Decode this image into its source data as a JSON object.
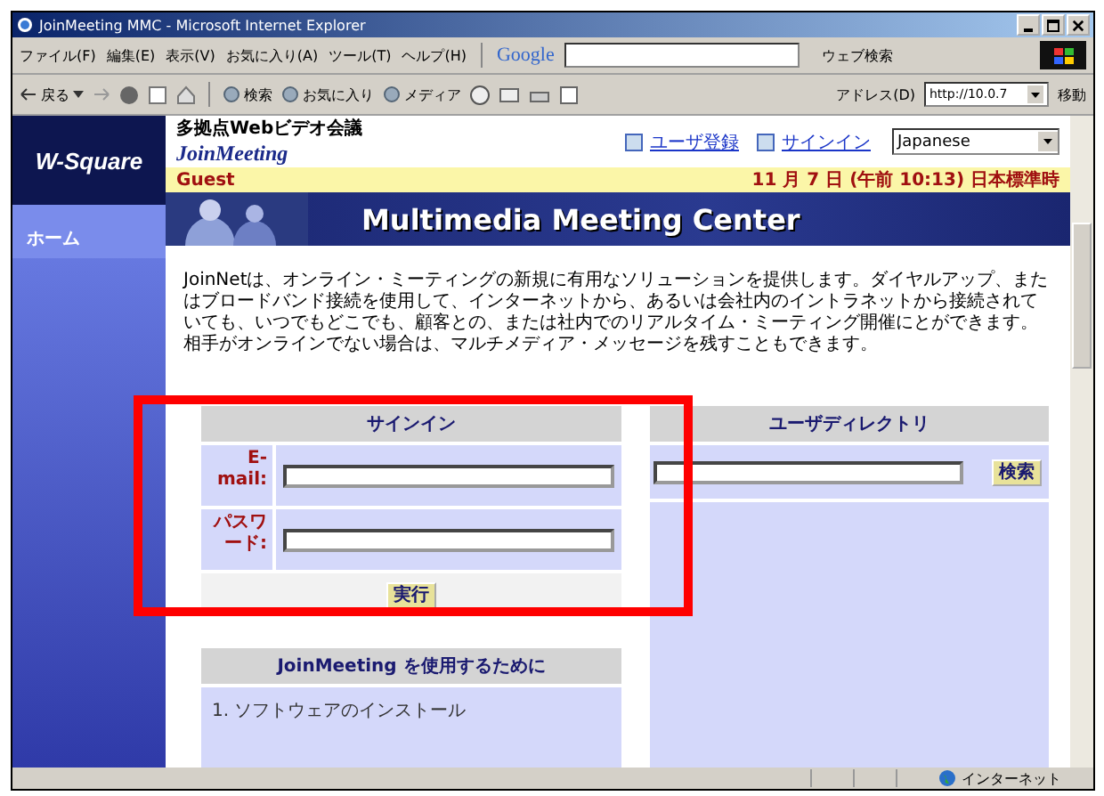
{
  "window": {
    "title": "JoinMeeting MMC - Microsoft Internet Explorer"
  },
  "menu": [
    "ファイル(F)",
    "編集(E)",
    "表示(V)",
    "お気に入り(A)",
    "ツール(T)",
    "ヘルプ(H)"
  ],
  "google_bar": {
    "logo": "Google",
    "search_button": "ウェブ検索"
  },
  "toolbar": {
    "back": "戻る",
    "buttons": [
      "検索",
      "お気に入り",
      "メディア"
    ],
    "address_label": "アドレス(D)",
    "address": "http://10.0.7",
    "go": "移動"
  },
  "header": {
    "tagline": "多拠点Webビデオ会議",
    "product": "JoinMeeting",
    "logo": "W-Square",
    "links": [
      "ユーザ登録",
      "サインイン"
    ],
    "language": "Japanese"
  },
  "info_bar": {
    "user": "Guest",
    "date": "11 月 7 日 (午前 10:13) 日本標準時"
  },
  "banner": {
    "title": "Multimedia Meeting Center"
  },
  "sidebar": {
    "items": [
      "ホーム"
    ]
  },
  "intro": "JoinNetは、オンライン・ミーティングの新規に有用なソリューションを提供します。ダイヤルアップ、またはブロードバンド接続を使用して、インターネットから、あるいは会社内のイントラネットから接続されていても、いつでもどこでも、顧客との、または社内でのリアルタイム・ミーティング開催にとができます。相手がオンラインでない場合は、マルチメディア・メッセージを残すこともできます。",
  "signin": {
    "title": "サインイン",
    "fields": [
      {
        "label": "E-mail:"
      },
      {
        "label": "パスワード:"
      }
    ],
    "submit": "実行"
  },
  "directory": {
    "title": "ユーザディレクトリ",
    "search_button": "検索"
  },
  "getting_started": {
    "title": "JoinMeeting を使用するために",
    "items": [
      "1. ソフトウェアのインストール"
    ]
  },
  "status_bar": {
    "zone": "インターネット"
  }
}
